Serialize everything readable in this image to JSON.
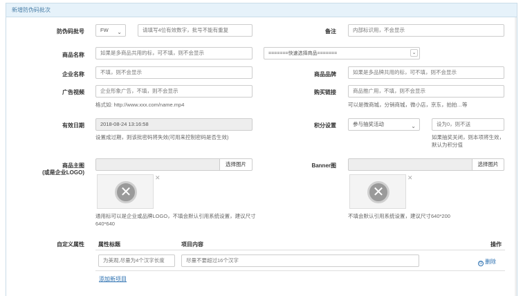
{
  "panel": {
    "title": "新增防伪码批次"
  },
  "fields": {
    "batch_no": {
      "label": "防伪码批号",
      "prefix": "FW",
      "placeholder": "请填写4位有效数字，批号不能有重复"
    },
    "remark": {
      "label": "备注",
      "placeholder": "内部标识用，不会显示"
    },
    "product_name": {
      "label": "商品名称",
      "placeholder": "如果是多商品共用的标，可不填，则不会显示"
    },
    "quick_select": {
      "value": "=======快速选择商品======="
    },
    "company_name": {
      "label": "企业名称",
      "placeholder": "不填，则不会显示"
    },
    "brand": {
      "label": "商品品牌",
      "placeholder": "如果是多品牌共用的标，可不填，则不会显示"
    },
    "ad_video": {
      "label": "广告视频",
      "placeholder": "企业形象广告，不填，则不会显示",
      "hint": "格式如: http://www.xxx.com/name.mp4"
    },
    "buy_link": {
      "label": "购买链接",
      "placeholder": "商品推广用，不填，则不会显示",
      "hint": "可以是微商城，分销商城，微小店，京东，拍拍…等"
    },
    "expire": {
      "label": "有效日期",
      "value": "2018-08-24 13:16:58",
      "hint": "设置成过期，则该批密码将失效(可用来控制密码是否生效)"
    },
    "points": {
      "label": "积分设置",
      "select": "参与抽奖活动",
      "placeholder": "设为0，则不送",
      "hint": "如果抽奖关闭，则本项将生效，默认为积分值"
    },
    "main_image": {
      "label_line1": "商品主图",
      "label_line2": "(或是企业LOGO)",
      "button": "选择图片",
      "hint": "通用标可以是企业或品牌LOGO，不填会默认引用系统设置，建议尺寸640*640"
    },
    "banner": {
      "label": "Banner图",
      "button": "选择图片",
      "hint": "不填会默认引用系统设置，建议尺寸640*200"
    }
  },
  "custom_attrs": {
    "label": "自定义属性",
    "headers": {
      "name": "属性标题",
      "content": "项目内容",
      "action": "操作"
    },
    "row": {
      "name_placeholder": "为美观,尽量为4个汉字长度",
      "content_placeholder": "尽量不要超过16个汉字",
      "delete": "删除"
    },
    "add_link": "添加新项目"
  },
  "icons": {
    "image_placeholder": "broken-image-icon",
    "remove": "close-icon",
    "dropdown": "chevron-down-icon",
    "delete": "delete-circle-icon"
  }
}
